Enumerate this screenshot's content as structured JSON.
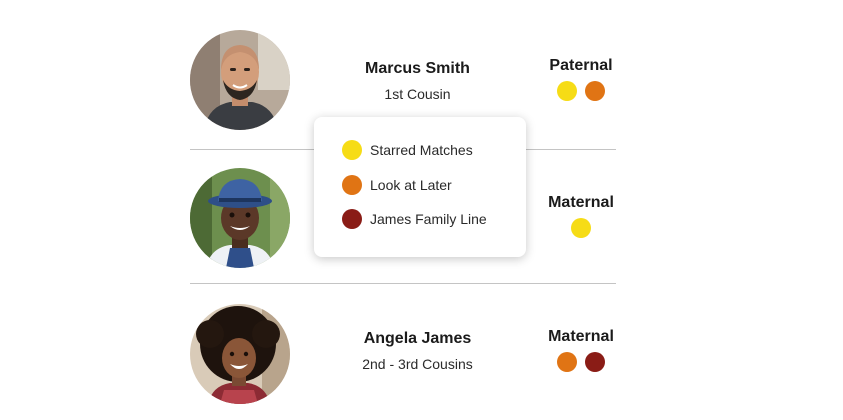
{
  "colors": {
    "starred": "#f6dc16",
    "later": "#e07414",
    "james": "#8a1c16"
  },
  "matches": [
    {
      "name": "Marcus Smith",
      "relationship": "1st Cousin",
      "side": "Paternal",
      "groups": [
        "starred",
        "later"
      ],
      "photo": "profile-photo-marcus"
    },
    {
      "name": "",
      "relationship": "",
      "side": "Maternal",
      "groups": [
        "starred"
      ],
      "photo": "profile-photo-man-hat"
    },
    {
      "name": "Angela James",
      "relationship": "2nd - 3rd Cousins",
      "side": "Maternal",
      "groups": [
        "later",
        "james"
      ],
      "photo": "profile-photo-angela"
    }
  ],
  "legend_popup": {
    "items": [
      {
        "label": "Starred Matches",
        "color_key": "starred"
      },
      {
        "label": "Look at Later",
        "color_key": "later"
      },
      {
        "label": "James Family Line",
        "color_key": "james"
      }
    ]
  }
}
